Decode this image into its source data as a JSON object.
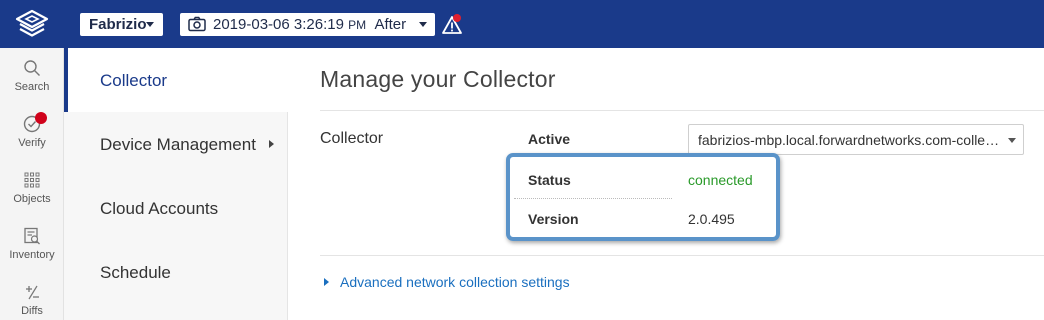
{
  "header": {
    "user": "Fabrizio",
    "snapshot": {
      "datetime": "2019-03-06 3:26:19",
      "ampm": "PM",
      "mode": "After"
    }
  },
  "rail": [
    {
      "label": "Search",
      "icon": "search-icon"
    },
    {
      "label": "Verify",
      "icon": "verify-icon"
    },
    {
      "label": "Objects",
      "icon": "grid-icon"
    },
    {
      "label": "Inventory",
      "icon": "inventory-icon"
    },
    {
      "label": "Diffs",
      "icon": "diff-icon"
    }
  ],
  "nav": {
    "items": [
      {
        "label": "Collector"
      },
      {
        "label": "Device Management"
      },
      {
        "label": "Cloud Accounts"
      },
      {
        "label": "Schedule"
      }
    ]
  },
  "main": {
    "title": "Manage your Collector",
    "section": "Collector",
    "active_label": "Active",
    "active_value": "fabrizios-mbp.local.forwardnetworks.com-colle…",
    "status_label": "Status",
    "status_value": "connected",
    "version_label": "Version",
    "version_value": "2.0.495",
    "advanced_link": "Advanced network collection settings"
  },
  "colors": {
    "topbar": "#1a3a8a",
    "connected": "#2a9a2a",
    "link": "#1a6fbf",
    "highlight": "#5a93c9",
    "alert": "#d0021b"
  }
}
